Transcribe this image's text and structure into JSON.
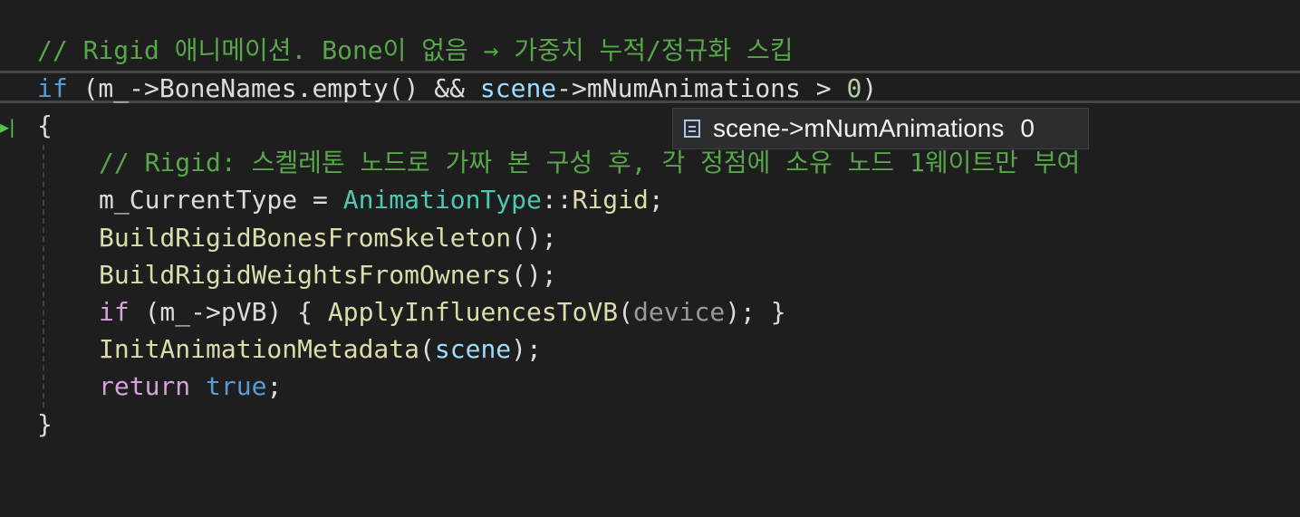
{
  "editor": {
    "line1": {
      "comment": "// Rigid 애니메이션. Bone이 없음 → 가중치 누적/정규화 스킵"
    },
    "line2": {
      "kw_if": "if",
      "p1": " (m_->BoneNames.empty() && ",
      "scene": "scene",
      "p2": "->mNumAnimations > ",
      "zero": "0",
      "p3": ")"
    },
    "line3": {
      "brace": "{"
    },
    "line4": {
      "comment": "// Rigid: 스켈레톤 노드로 가짜 본 구성 후, 각 정점에 소유 노드 1웨이트만 부여"
    },
    "line5": {
      "lhs": "m_CurrentType = ",
      "type": "AnimationType",
      "sep": "::",
      "member": "Rigid",
      "semi": ";"
    },
    "line6": {
      "fn": "BuildRigidBonesFromSkeleton",
      "rest": "();"
    },
    "line7": {
      "fn": "BuildRigidWeightsFromOwners",
      "rest": "();"
    },
    "line8": {
      "kw_if": "if",
      "cond": " (m_->pVB) { ",
      "fn": "ApplyInfluencesToVB",
      "open": "(",
      "param": "device",
      "close": "); }"
    },
    "line9": {
      "fn": "InitAnimationMetadata",
      "open": "(",
      "arg": "scene",
      "close": ");"
    },
    "line10": {
      "kw_return": "return",
      "space": " ",
      "kw_true": "true",
      "semi": ";"
    },
    "line11": {
      "brace": "}"
    }
  },
  "gutter": {
    "arrow": "▸|"
  },
  "tooltip": {
    "icon": "field-icon",
    "expression": "scene->mNumAnimations",
    "value": "0"
  }
}
